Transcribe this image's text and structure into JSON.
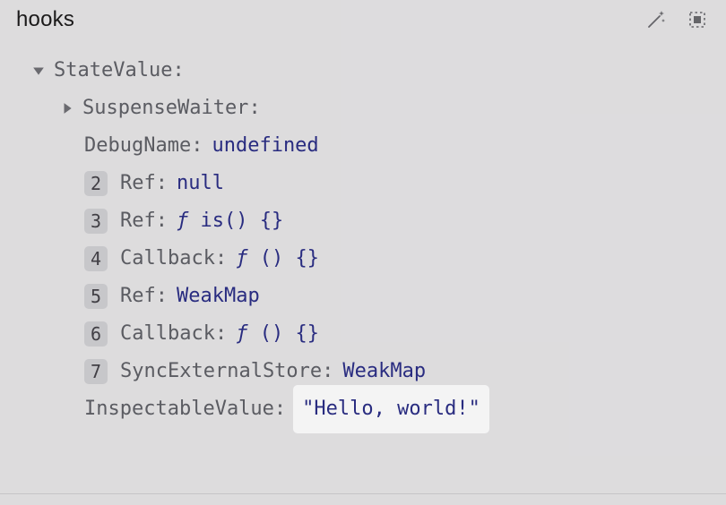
{
  "header": {
    "title": "hooks",
    "wand_icon": "magic-wand-icon",
    "inspect_icon": "bounding-box-icon"
  },
  "tree": {
    "root": {
      "name": "StateValue",
      "expanded": true,
      "children": [
        {
          "name": "SuspenseWaiter",
          "expandable": true,
          "expanded": false
        },
        {
          "name": "DebugName",
          "value_kind": "undefined",
          "value": "undefined"
        },
        {
          "badge": "2",
          "name": "Ref",
          "value_kind": "null",
          "value": "null"
        },
        {
          "badge": "3",
          "name": "Ref",
          "value_kind": "func",
          "value_fn_name": "is()",
          "value_fn_body": "{}"
        },
        {
          "badge": "4",
          "name": "Callback",
          "value_kind": "func",
          "value_fn_name": "()",
          "value_fn_body": "{}"
        },
        {
          "badge": "5",
          "name": "Ref",
          "value_kind": "object",
          "value": "WeakMap"
        },
        {
          "badge": "6",
          "name": "Callback",
          "value_kind": "func",
          "value_fn_name": "()",
          "value_fn_body": "{}"
        },
        {
          "badge": "7",
          "name": "SyncExternalStore",
          "value_kind": "object",
          "value": "WeakMap"
        },
        {
          "name": "InspectableValue",
          "value_kind": "string",
          "value": "\"Hello, world!\"",
          "highlighted": true
        }
      ]
    }
  },
  "glyphs": {
    "fn": "ƒ"
  }
}
